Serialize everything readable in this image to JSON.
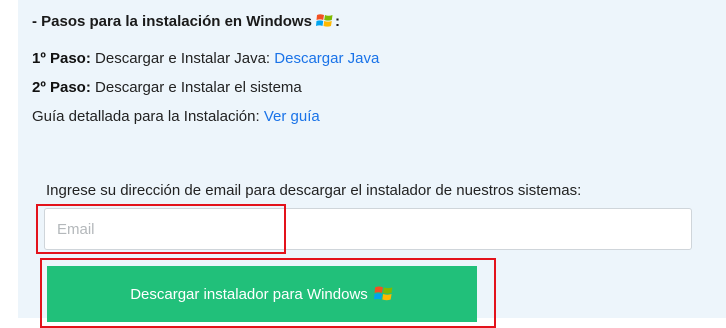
{
  "install": {
    "heading_prefix": "- Pasos para la instalación en Windows",
    "heading_suffix": ":",
    "step1": {
      "label": "1º Paso:",
      "text": "Descargar e Instalar Java:",
      "link": "Descargar Java"
    },
    "step2": {
      "label": "2º Paso:",
      "text": "Descargar e Instalar el sistema"
    },
    "guide": {
      "text": "Guía detallada para la Instalación:",
      "link": "Ver guía"
    }
  },
  "download_form": {
    "prompt": "Ingrese su dirección de email para descargar el instalador de nuestros sistemas:",
    "email_placeholder": "Email",
    "email_value": "",
    "button_label": "Descargar instalador para Windows",
    "button_color": "#21c07a"
  },
  "icons": {
    "windows": "windows-logo-icon"
  },
  "colors": {
    "link": "#1a73e8",
    "highlight": "#e3121b",
    "panel_bg": "#edf5fb"
  }
}
